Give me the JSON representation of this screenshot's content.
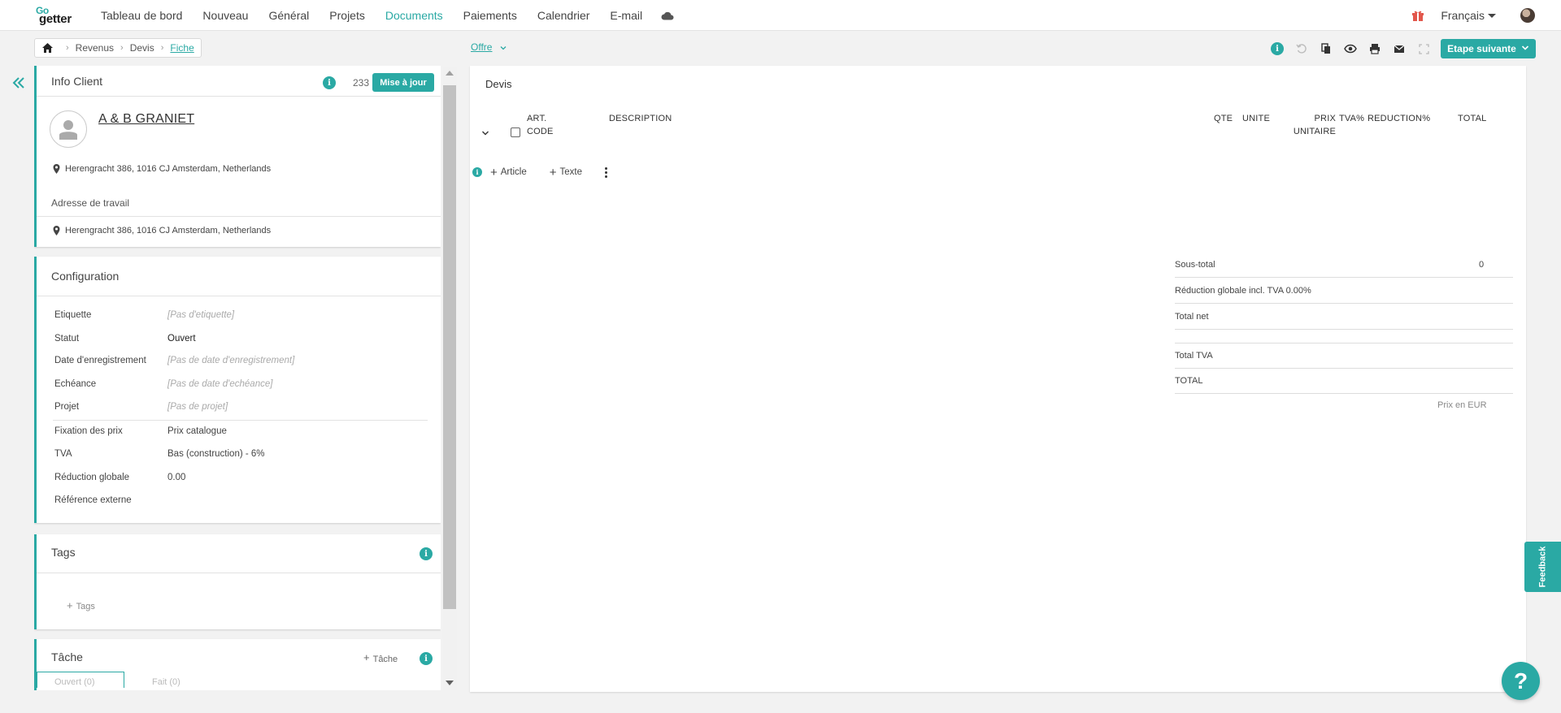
{
  "nav": {
    "logo_top": "Go",
    "logo_bottom": "getter",
    "items": [
      {
        "label": "Tableau de bord"
      },
      {
        "label": "Nouveau"
      },
      {
        "label": "Général"
      },
      {
        "label": "Projets"
      },
      {
        "label": "Documents",
        "active": true
      },
      {
        "label": "Paiements"
      },
      {
        "label": "Calendrier"
      },
      {
        "label": "E-mail"
      }
    ],
    "language": "Français"
  },
  "breadcrumb": {
    "items": [
      "Revenus",
      "Devis",
      "Fiche"
    ]
  },
  "document_type": "Offre",
  "toolbar": {
    "next_step_label": "Etape suivante"
  },
  "info_client": {
    "title": "Info Client",
    "count": "233",
    "update_label": "Mise à jour",
    "client_name": "A & B GRANIET",
    "address": "Herengracht 386, 1016 CJ Amsterdam, Netherlands",
    "work_address_label": "Adresse de travail",
    "work_address": "Herengracht 386, 1016 CJ Amsterdam, Netherlands"
  },
  "configuration": {
    "title": "Configuration",
    "rows": [
      {
        "label": "Etiquette",
        "value": "[Pas d'etiquette]"
      },
      {
        "label": "Statut",
        "value": "Ouvert"
      },
      {
        "label": "Date d'enregistrement",
        "value": "[Pas de date d'enregistrement]"
      },
      {
        "label": "Echéance",
        "value": "[Pas de date d'echéance]"
      },
      {
        "label": "Projet",
        "value": "[Pas de projet]"
      },
      {
        "label": "Fixation des prix",
        "value": "Prix catalogue"
      },
      {
        "label": "TVA",
        "value": "Bas (construction) - 6%"
      },
      {
        "label": "Réduction globale",
        "value": "0.00"
      },
      {
        "label": "Référence externe",
        "value": ""
      }
    ]
  },
  "tags": {
    "title": "Tags",
    "add_label": "Tags"
  },
  "tache": {
    "title": "Tâche",
    "add_label": "Tâche",
    "tabs": [
      "Ouvert (0)",
      "Fait (0)"
    ]
  },
  "devis": {
    "title": "Devis",
    "columns": {
      "art_code_1": "ART.",
      "art_code_2": "CODE",
      "description": "DESCRIPTION",
      "qte": "QTE",
      "unite": "UNITE",
      "prix_1": "PRIX",
      "prix_2": "UNITAIRE",
      "tva": "TVA%",
      "reduction": "REDUCTION%",
      "total": "TOTAL"
    },
    "add_article": "Article",
    "add_texte": "Texte",
    "totals": {
      "sous_total_label": "Sous-total",
      "sous_total_value": "0",
      "reduction_label": "Réduction globale incl. TVA 0.00%",
      "total_net_label": "Total net",
      "total_tva_label": "Total TVA",
      "total_label": "TOTAL"
    },
    "currency_note": "Prix en EUR"
  },
  "feedback_label": "Feedback",
  "help_label": "?",
  "colors": {
    "accent": "#2aa9a4"
  }
}
